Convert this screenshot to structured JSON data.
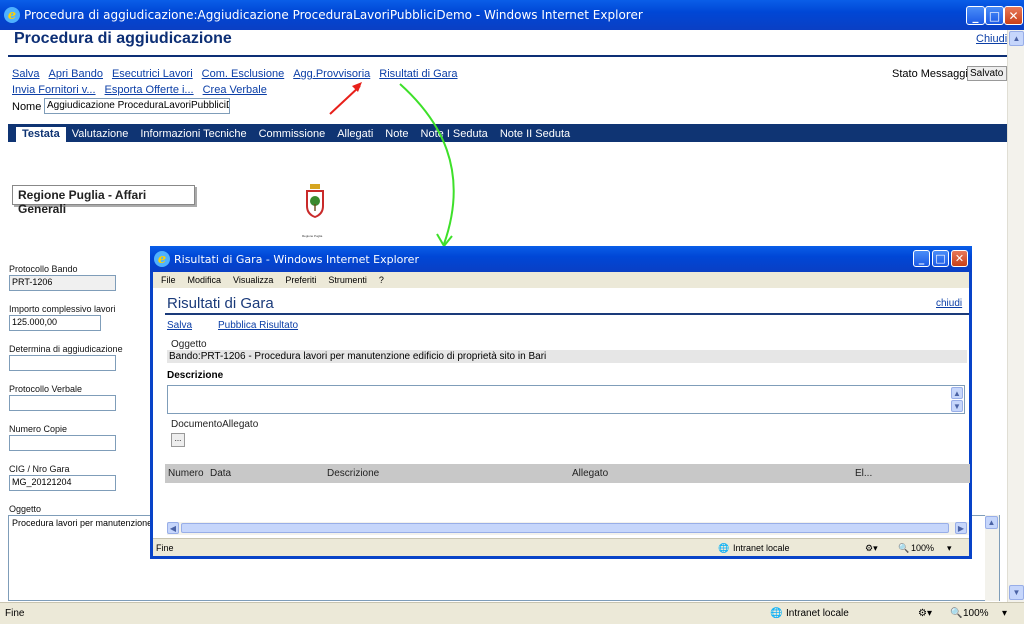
{
  "window": {
    "title": "Procedura di aggiudicazione:Aggiudicazione ProceduraLavoriPubbliciDemo - Windows Internet Explorer"
  },
  "page": {
    "title": "Procedura di aggiudicazione",
    "close_link": "Chiudi",
    "toolbar_row1": [
      "Salva",
      "Apri Bando",
      "Esecutrici Lavori",
      "Com. Esclusione",
      "Agg.Provvisoria",
      "Risultati di Gara"
    ],
    "toolbar_row2": [
      "Invia Fornitori v...",
      "Esporta Offerte i...",
      "Crea Verbale"
    ],
    "stato_label": "Stato Messaggio",
    "stato_value": "Salvato",
    "nome_label": "Nome",
    "nome_value": "Aggiudicazione ProceduraLavoriPubbliciD"
  },
  "tabs": [
    "Testata",
    "Valutazione",
    "Informazioni Tecniche",
    "Commissione",
    "Allegati",
    "Note",
    "Note I Seduta",
    "Note II Seduta"
  ],
  "org_name": "Regione Puglia - Affari Generali",
  "emblem_caption": "Regione Puglia",
  "fields": {
    "protocollo_bando": {
      "label": "Protocollo Bando",
      "value": "PRT-1206"
    },
    "importo": {
      "label": "Importo complessivo lavori",
      "value": "125.000,00"
    },
    "determina": {
      "label": "Determina di aggiudicazione",
      "value": ""
    },
    "protocollo_verbale": {
      "label": "Protocollo Verbale",
      "value": ""
    },
    "numero_copie": {
      "label": "Numero Copie",
      "value": ""
    },
    "cig": {
      "label": "CIG / Nro Gara",
      "value": "MG_20121204"
    },
    "oggetto": {
      "label": "Oggetto",
      "value": "Procedura lavori per manutenzione e"
    }
  },
  "statusbar": {
    "left": "Fine",
    "zone": "Intranet locale",
    "zoom": "100%"
  },
  "popup": {
    "window_title": "Risultati di Gara - Windows Internet Explorer",
    "menu": [
      "File",
      "Modifica",
      "Visualizza",
      "Preferiti",
      "Strumenti",
      "?"
    ],
    "title": "Risultati di Gara",
    "close_link": "chiudi",
    "actions": [
      "Salva",
      "Pubblica Risultato"
    ],
    "oggetto_label": "Oggetto",
    "oggetto_value": "Bando:PRT-1206 - Procedura lavori per manutenzione edificio di proprietà sito in Bari",
    "descrizione_label": "Descrizione",
    "documento_label": "DocumentoAllegato",
    "documento_button": "...",
    "grid_columns": [
      "Numero",
      "Data",
      "Descrizione",
      "Allegato",
      "El..."
    ],
    "status_left": "Fine",
    "status_zone": "Intranet locale",
    "status_zoom": "100%"
  },
  "colors": {
    "xp_titlebar": "#0a5ee8",
    "tabbar": "#0f3473",
    "link": "#0b3ea6",
    "arrow_red": "#e8201a",
    "arrow_green": "#3ee02a"
  }
}
